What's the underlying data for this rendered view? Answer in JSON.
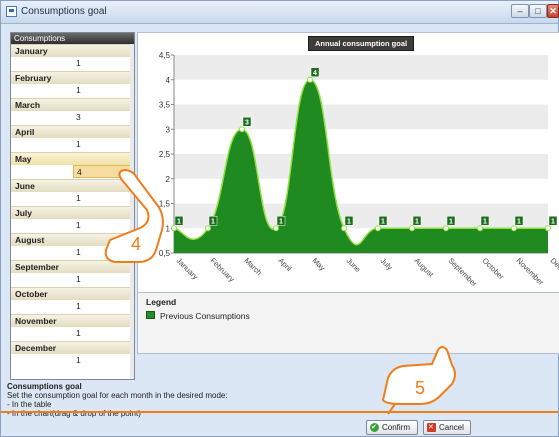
{
  "window": {
    "title": "Consumptions goal",
    "min_icon": "minimize-icon",
    "max_icon": "maximize-icon",
    "close_icon": "close-icon"
  },
  "table": {
    "header": "Consumptions",
    "months": [
      {
        "label": "January",
        "value": "1"
      },
      {
        "label": "February",
        "value": "1"
      },
      {
        "label": "March",
        "value": "3"
      },
      {
        "label": "April",
        "value": "1"
      },
      {
        "label": "May",
        "value": "4"
      },
      {
        "label": "June",
        "value": "1"
      },
      {
        "label": "July",
        "value": "1"
      },
      {
        "label": "August",
        "value": "1"
      },
      {
        "label": "September",
        "value": "1"
      },
      {
        "label": "October",
        "value": "1"
      },
      {
        "label": "November",
        "value": "1"
      },
      {
        "label": "December",
        "value": "1"
      }
    ],
    "selected": "May"
  },
  "chart_data": {
    "type": "area",
    "title": "Annual consumption goal",
    "categories": [
      "January",
      "February",
      "March",
      "April",
      "May",
      "June",
      "July",
      "August",
      "September",
      "October",
      "November",
      "December"
    ],
    "series": [
      {
        "name": "Previous Consumptions",
        "values": [
          1,
          1,
          3,
          1,
          4,
          1,
          1,
          1,
          1,
          1,
          1,
          1
        ]
      }
    ],
    "yticks": [
      "0,5",
      "1",
      "1,5",
      "2",
      "2,5",
      "3",
      "3,5",
      "4",
      "4,5"
    ],
    "ylim": [
      0.5,
      4.5
    ],
    "grid": true,
    "legend": "bottom-left",
    "colors": {
      "fill": "#1f8a1f",
      "line": "#8fe040",
      "label_bg": "#1b6e1b"
    }
  },
  "legend": {
    "title": "Legend",
    "item": "Previous Consumptions"
  },
  "description": {
    "title": "Consumptions goal",
    "line1": "Set the consumption goal for each month in the desired mode:",
    "line2": "- In the table",
    "line3": "- In the chart(drag & drop of the point)"
  },
  "buttons": {
    "confirm": "Confirm",
    "cancel": "Cancel"
  },
  "callouts": {
    "a": "4",
    "b": "5",
    "color": "#f07d1a"
  }
}
